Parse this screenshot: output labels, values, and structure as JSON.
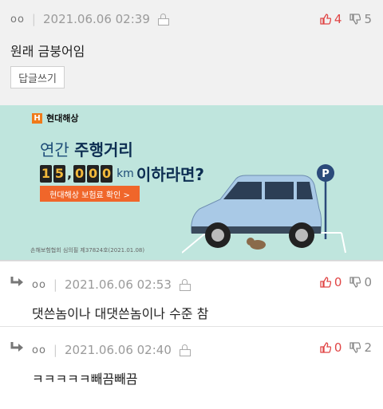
{
  "comments": [
    {
      "nick": "oo",
      "sep": "|",
      "date": "2021.06.06 02:39",
      "upvotes": "4",
      "downvotes": "5",
      "text": "원래 금붕어임",
      "reply_label": "답글쓰기"
    },
    {
      "nick": "oo",
      "sep": "|",
      "date": "2021.06.06 02:53",
      "upvotes": "0",
      "downvotes": "0",
      "text": "댓쓴놈이나 대댓쓴놈이나 수준 참"
    },
    {
      "nick": "oo",
      "sep": "|",
      "date": "2021.06.06 02:40",
      "upvotes": "0",
      "downvotes": "2",
      "text": "ㅋㅋㅋㅋㅋ빼끔빼끔"
    }
  ],
  "ad": {
    "brand": "현대해상",
    "line1_prefix": "연간",
    "line1_bold": "주행거리",
    "digits": [
      "1",
      "5",
      "0",
      "0",
      "0"
    ],
    "comma": ",",
    "unit": "km",
    "line2_suffix": "이하라면?",
    "button": "현대해상 보험료 확인 >",
    "fine_print": "손해보험협회 심의필 제37824호(2021.01.08)",
    "parking_sign": "P",
    "colors": {
      "background": "#bfe5dd",
      "accent": "#f0662a",
      "car": "#a9c9e6"
    }
  },
  "colors": {
    "upvote": "#e04545",
    "downvote": "#888888"
  },
  "icons": {
    "lock": "lock-icon",
    "thumb_up": "thumb-up-icon",
    "thumb_down": "thumb-down-icon",
    "reply": "reply-arrow-icon"
  }
}
